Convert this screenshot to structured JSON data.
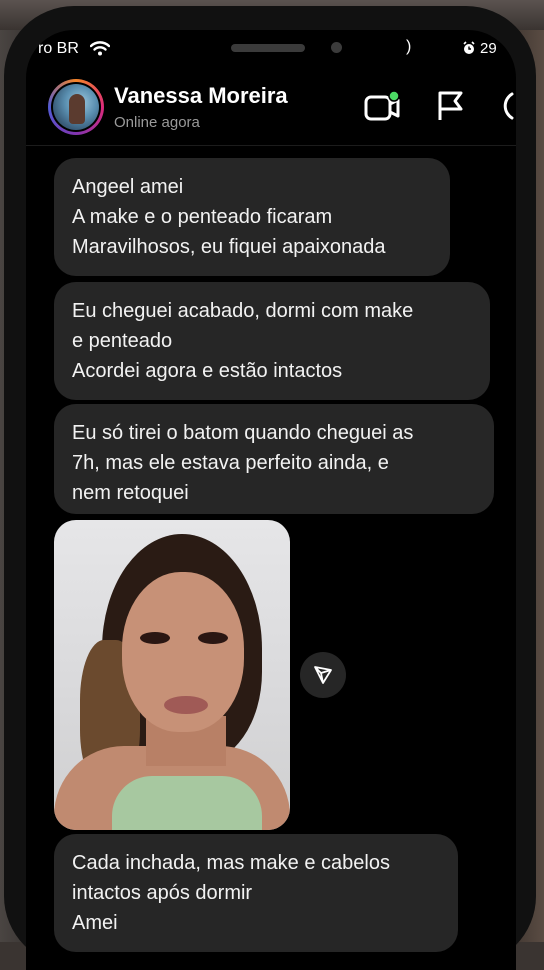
{
  "status_bar": {
    "carrier": "ro BR",
    "mark": ")",
    "time": "29"
  },
  "header": {
    "name": "Vanessa Moreira",
    "status": "Online agora",
    "icons": [
      "video-call-icon",
      "flag-icon",
      "info-icon"
    ]
  },
  "messages": [
    {
      "lines": [
        "Angeel amei",
        "A make e o penteado ficaram",
        "Maravilhosos, eu fiquei apaixonada"
      ]
    },
    {
      "lines": [
        "Eu cheguei acabado, dormi com make",
        "e penteado",
        "Acordei agora e estão intactos"
      ]
    },
    {
      "lines": [
        "Eu só tirei o batom quando cheguei as",
        "7h, mas ele estava perfeito ainda, e",
        "nem retoquei"
      ]
    },
    {
      "lines": [
        "Cada inchada, mas make e cabelos",
        "intactos após dormir",
        "Amei"
      ]
    }
  ],
  "colors": {
    "background": "#000000",
    "bubble": "#262626",
    "text": "#f2f2f2",
    "online_dot": "#4cd964"
  }
}
